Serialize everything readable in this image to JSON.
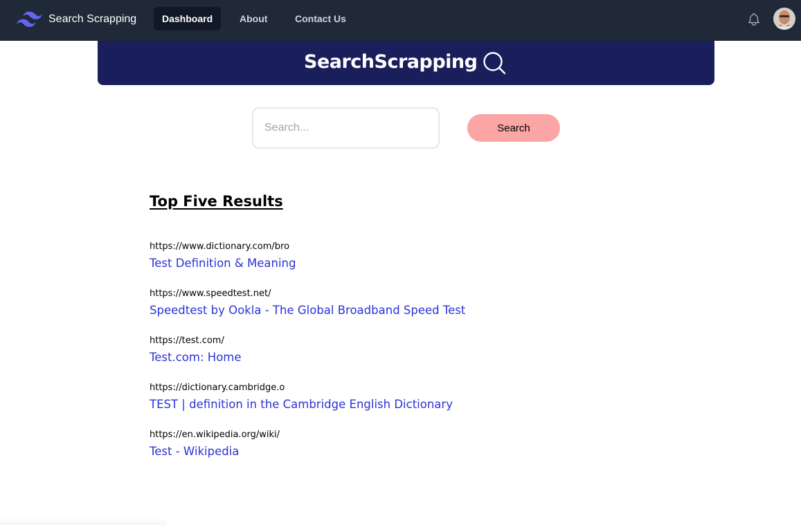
{
  "navbar": {
    "brand": "Search Scrapping",
    "links": [
      {
        "label": "Dashboard",
        "active": true
      },
      {
        "label": "About",
        "active": false
      },
      {
        "label": "Contact Us",
        "active": false
      }
    ],
    "icons": [
      "tailwind-logo",
      "bell-icon",
      "avatar"
    ]
  },
  "hero": {
    "title": "SearchScrapping",
    "icon": "search-icon"
  },
  "search": {
    "placeholder": "Search...",
    "button_label": "Search"
  },
  "results": {
    "heading": "Top Five Results",
    "items": [
      {
        "url": "https://www.dictionary.com/bro",
        "title": "Test Definition & Meaning"
      },
      {
        "url": "https://www.speedtest.net/",
        "title": "Speedtest by Ookla - The Global Broadband Speed Test"
      },
      {
        "url": "https://test.com/",
        "title": "Test.com: Home"
      },
      {
        "url": "https://dictionary.cambridge.o",
        "title": "TEST | definition in the Cambridge English Dictionary"
      },
      {
        "url": "https://en.wikipedia.org/wiki/",
        "title": "Test - Wikipedia"
      }
    ]
  },
  "colors": {
    "navbar_bg": "#1f2937",
    "hero_bg": "#1a1f5c",
    "button_bg": "#fca5a5",
    "link": "#2b33d6"
  }
}
